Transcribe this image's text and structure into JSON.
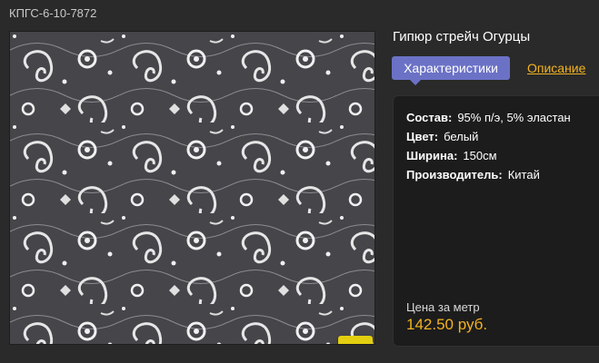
{
  "product": {
    "sku": "КПГС-6-10-7872",
    "title": "Гипюр стрейч Огурцы"
  },
  "tabs": {
    "active_label": "Характеристики",
    "link_label": "Описание"
  },
  "specs": [
    {
      "label": "Состав:",
      "value": "95% п/э, 5% эластан"
    },
    {
      "label": "Цвет:",
      "value": "белый"
    },
    {
      "label": "Ширина:",
      "value": "150см"
    },
    {
      "label": "Производитель:",
      "value": "Китай"
    }
  ],
  "price": {
    "label": "Цена за метр",
    "value": "142.50 руб."
  },
  "colors": {
    "accent_tab": "#6b72c6",
    "accent_price": "#f2b320",
    "zoom_button": "#e3cf10"
  },
  "icons": {
    "zoom": "zoom-in-icon"
  }
}
